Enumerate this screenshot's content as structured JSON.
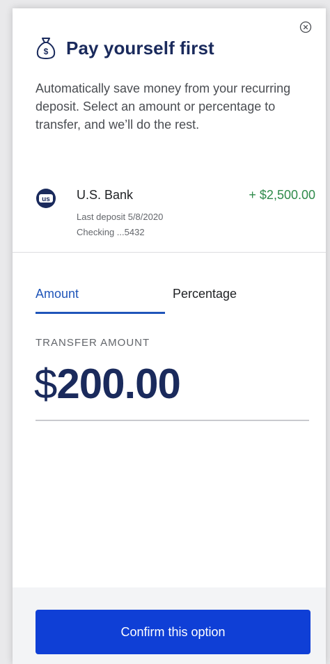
{
  "header": {
    "title": "Pay yourself first",
    "icon": "money-bag-icon",
    "close_icon": "close-icon"
  },
  "description": "Automatically save money from your recurring deposit. Select an amount or percentage to transfer, and we’ll do the rest.",
  "account": {
    "logo_text": "us",
    "bank_name": "U.S. Bank",
    "deposit_amount": "+ $2,500.00",
    "last_deposit": "Last deposit 5/8/2020",
    "account_label": "Checking ...5432"
  },
  "tabs": [
    {
      "label": "Amount",
      "active": true
    },
    {
      "label": "Percentage",
      "active": false
    }
  ],
  "transfer": {
    "label": "TRANSFER AMOUNT",
    "currency_symbol": "$",
    "value": "200.00"
  },
  "footer": {
    "confirm_label": "Confirm this option"
  },
  "colors": {
    "brand_navy": "#1a2a5c",
    "accent_blue": "#1f55b9",
    "button_blue": "#0f3fd6",
    "positive_green": "#2e8a4a"
  }
}
